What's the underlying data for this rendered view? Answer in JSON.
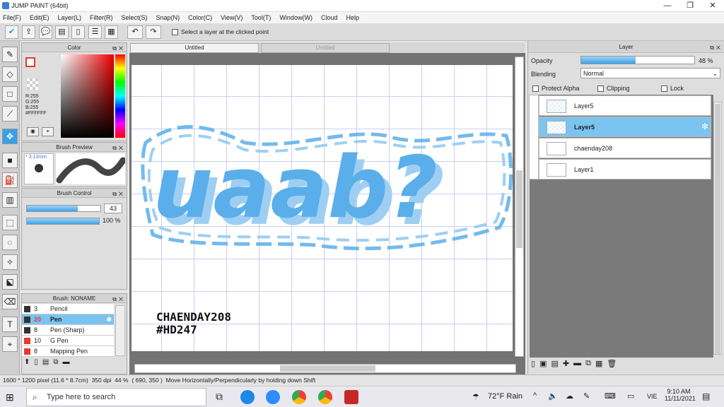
{
  "window": {
    "title": "JUMP PAINT (64bit)",
    "minimize": "—",
    "maximize": "❐",
    "close": "✕"
  },
  "menu": [
    "File(F)",
    "Edit(E)",
    "Layer(L)",
    "Filter(R)",
    "Select(S)",
    "Snap(N)",
    "Color(C)",
    "View(V)",
    "Tool(T)",
    "Window(W)",
    "Cloud",
    "Help"
  ],
  "toolbar": {
    "select_layer_label": "Select a layer at the clicked point",
    "icons": [
      "check-icon",
      "export-icon",
      "speech-icon",
      "note-icon",
      "document-icon",
      "list-icon",
      "grid-icon",
      "undo-icon",
      "redo-icon"
    ]
  },
  "tabs": [
    "Untitled",
    "Untitled"
  ],
  "color_panel": {
    "title": "Color",
    "r": "R:255",
    "g": "G:255",
    "b": "B:255",
    "hex": "#FFFFFF"
  },
  "brush_preview": {
    "title": "Brush Preview",
    "size": "* 3.13mm"
  },
  "brush_control": {
    "title": "Brush Control",
    "size_value": "43",
    "opacity_value": "100 %",
    "size_fraction": 0.43,
    "opacity_fraction": 1.0
  },
  "brush_list": {
    "title": "Brush: NONAME",
    "items": [
      {
        "size": "3",
        "name": "Pencil",
        "color": "#333333"
      },
      {
        "size": "20",
        "name": "Pen",
        "color": "#333333",
        "selected": true
      },
      {
        "size": "8",
        "name": "Pen (Sharp)",
        "color": "#333333"
      },
      {
        "size": "10",
        "name": "G Pen",
        "color": "#e53935"
      },
      {
        "size": "8",
        "name": "Mapping Pen",
        "color": "#e53935"
      }
    ]
  },
  "layer_panel": {
    "title": "Layer",
    "opacity_label": "Opacity",
    "opacity_value": "48 %",
    "opacity_fraction": 0.48,
    "blending_label": "Blending",
    "blending_value": "Normal",
    "protect_alpha": "Protect Alpha",
    "clipping": "Clipping",
    "lock": "Lock",
    "layers": [
      {
        "name": "Layer5",
        "selected": false
      },
      {
        "name": "Layer5",
        "selected": true
      },
      {
        "name": "chaenday208",
        "selected": false
      },
      {
        "name": "Layer1",
        "selected": false
      }
    ]
  },
  "canvas": {
    "art_text": "uaab?",
    "signature_line1": "CHAENDAY208",
    "signature_line2": "#HD247",
    "accent": "#5aaeea"
  },
  "status": {
    "pixels": "1600 * 1200 pixel",
    "size": "(11.6 * 8.7cm)",
    "dpi": "350 dpi",
    "zoom": "44 %",
    "coords": "( 690, 350 )",
    "hint": "Move Horizontally/Perpendicularly by holding down Shift"
  },
  "taskbar": {
    "search_placeholder": "Type here to search",
    "weather": "72°F Rain",
    "lang": "VIE",
    "time": "9:10 AM",
    "date": "11/11/2021"
  }
}
